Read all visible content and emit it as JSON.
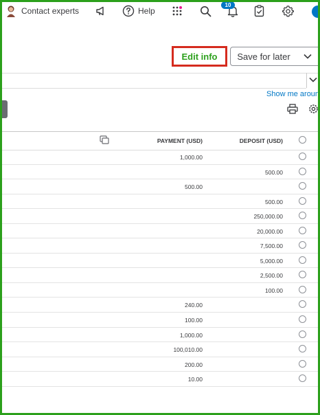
{
  "topbar": {
    "contact_label": "Contact experts",
    "help_label": "Help",
    "notification_count": "10",
    "accent_color": "#0077c5",
    "apps_dot_color": "#e8168f"
  },
  "actions": {
    "edit_label": "Edit info",
    "save_label": "Save for later"
  },
  "panel": {
    "show_me_link": "Show me aroun"
  },
  "table": {
    "columns": {
      "payment": "PAYMENT (USD)",
      "deposit": "DEPOSIT (USD)"
    },
    "rows": [
      {
        "payment": "1,000.00",
        "deposit": ""
      },
      {
        "payment": "",
        "deposit": "500.00"
      },
      {
        "payment": "500.00",
        "deposit": ""
      },
      {
        "payment": "",
        "deposit": "500.00"
      },
      {
        "payment": "",
        "deposit": "250,000.00"
      },
      {
        "payment": "",
        "deposit": "20,000.00"
      },
      {
        "payment": "",
        "deposit": "7,500.00"
      },
      {
        "payment": "",
        "deposit": "5,000.00"
      },
      {
        "payment": "",
        "deposit": "2,500.00"
      },
      {
        "payment": "",
        "deposit": "100.00"
      },
      {
        "payment": "240.00",
        "deposit": ""
      },
      {
        "payment": "100.00",
        "deposit": ""
      },
      {
        "payment": "1,000.00",
        "deposit": ""
      },
      {
        "payment": "100,010.00",
        "deposit": ""
      },
      {
        "payment": "200.00",
        "deposit": ""
      },
      {
        "payment": "10.00",
        "deposit": ""
      }
    ]
  },
  "colors": {
    "frame_border": "#2ca01c",
    "edit_button_border": "#d52b1e",
    "edit_button_text": "#2ca01c",
    "link": "#0077c5"
  }
}
